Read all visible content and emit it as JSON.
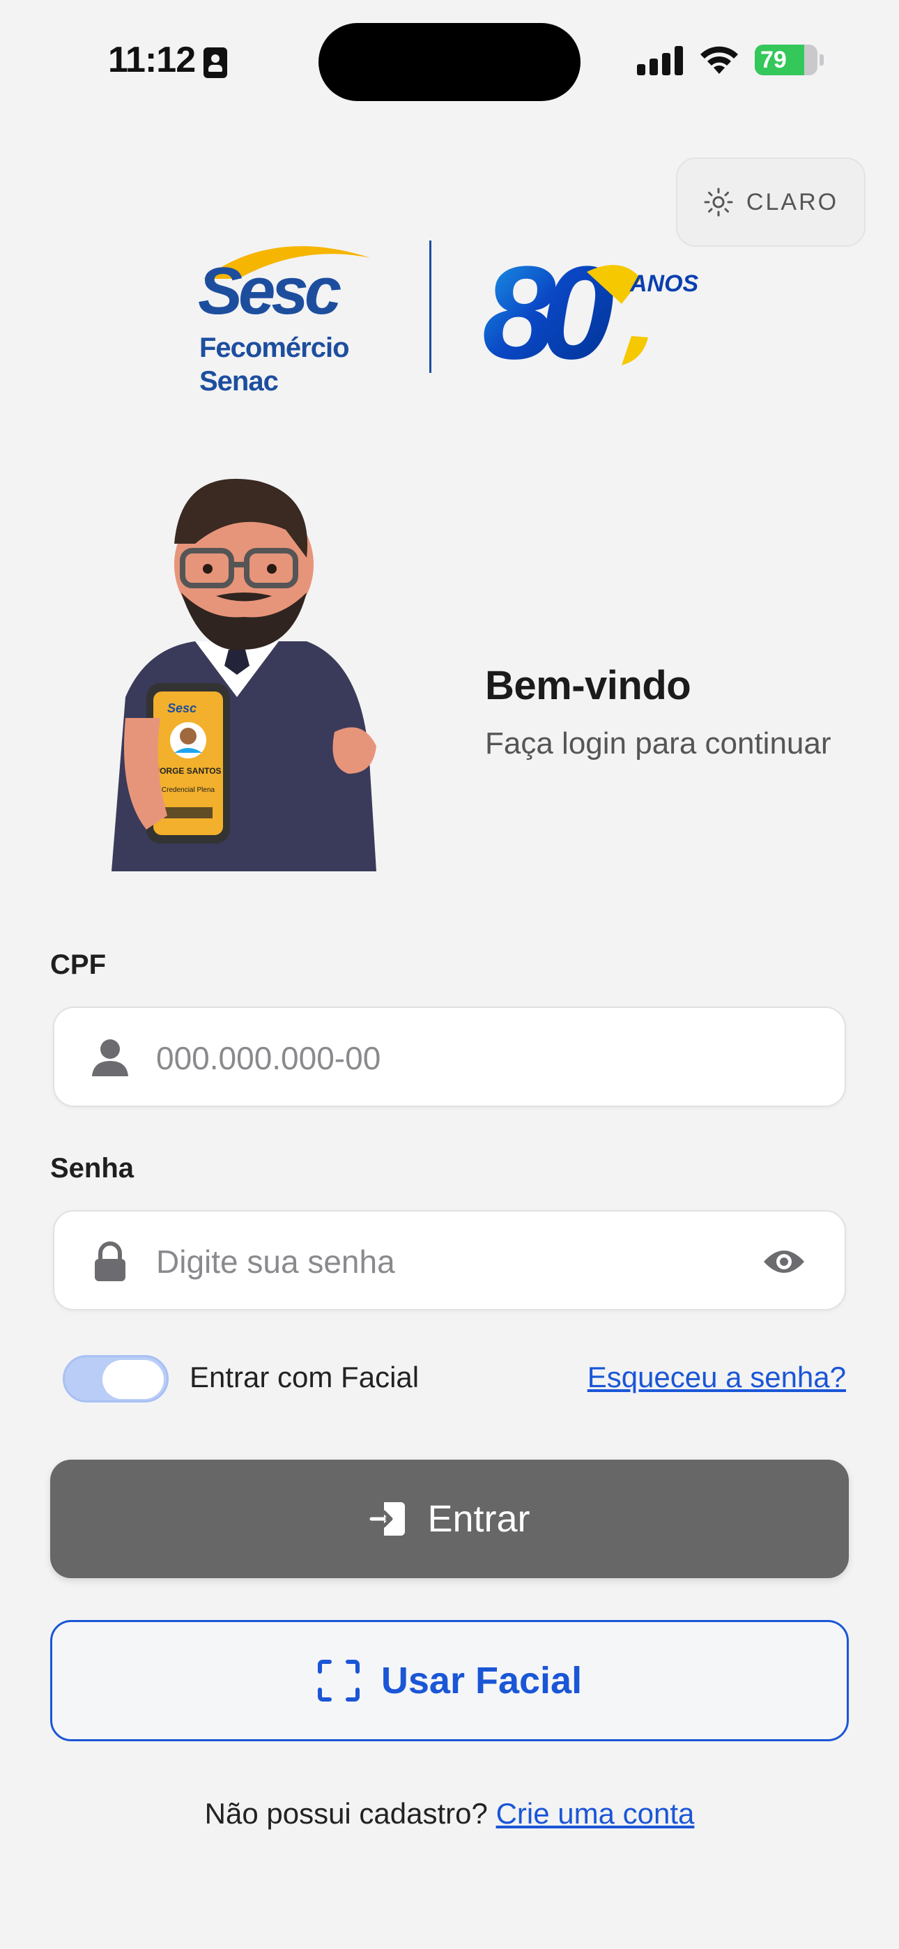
{
  "status_bar": {
    "time": "11:12",
    "battery_level": "79",
    "battery_fraction": 0.79,
    "signal_bars": 4
  },
  "theme_toggle": {
    "label": "CLARO",
    "icon": "sun-icon"
  },
  "logos": {
    "sesc_word": "Sesc",
    "sesc_sub1": "Fecomércio",
    "sesc_sub2": "Senac",
    "anniversary_number": "80",
    "anniversary_word": "ANOS"
  },
  "mascot_card": {
    "name": "JORGE SANTOS",
    "title": "Credencial Plena",
    "brand": "Sesc"
  },
  "welcome": {
    "title": "Bem-vindo",
    "subtitle": "Faça login para continuar"
  },
  "form": {
    "cpf_label": "CPF",
    "cpf_placeholder": "000.000.000-00",
    "password_label": "Senha",
    "password_placeholder": "Digite sua senha",
    "facial_toggle_label": "Entrar com Facial",
    "facial_toggle_on": true,
    "forgot_password": "Esqueceu a senha?"
  },
  "buttons": {
    "login_label": "Entrar",
    "facial_label": "Usar Facial"
  },
  "signup": {
    "prompt": "Não possui cadastro?",
    "link": "Crie uma conta"
  },
  "colors": {
    "background": "#f3f3f4",
    "accent_blue": "#1a56d6",
    "login_button": "#676767",
    "battery_green": "#34c759",
    "sesc_navy": "#1d4e9e",
    "sesc_yellow": "#f6b500"
  }
}
